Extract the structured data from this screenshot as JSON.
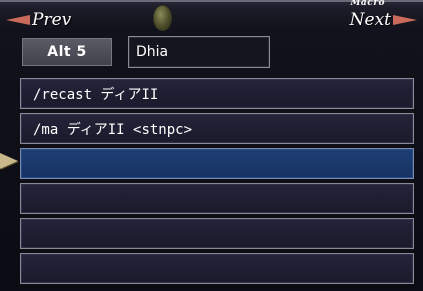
{
  "header": {
    "title": "Macro",
    "prev_label": "Prev",
    "next_label": "Next"
  },
  "macro_set": {
    "tab_label": "Alt 5",
    "name": "Dhia"
  },
  "lines": [
    {
      "text": "/recast ディアII"
    },
    {
      "text": "/ma ディアII <stnpc>"
    },
    {
      "text": "",
      "selected": true
    },
    {
      "text": ""
    },
    {
      "text": ""
    },
    {
      "text": ""
    }
  ],
  "colors": {
    "selected_line": "#1e3f75",
    "arrow": "#c96a5a",
    "pointer": "#c8b88a"
  }
}
